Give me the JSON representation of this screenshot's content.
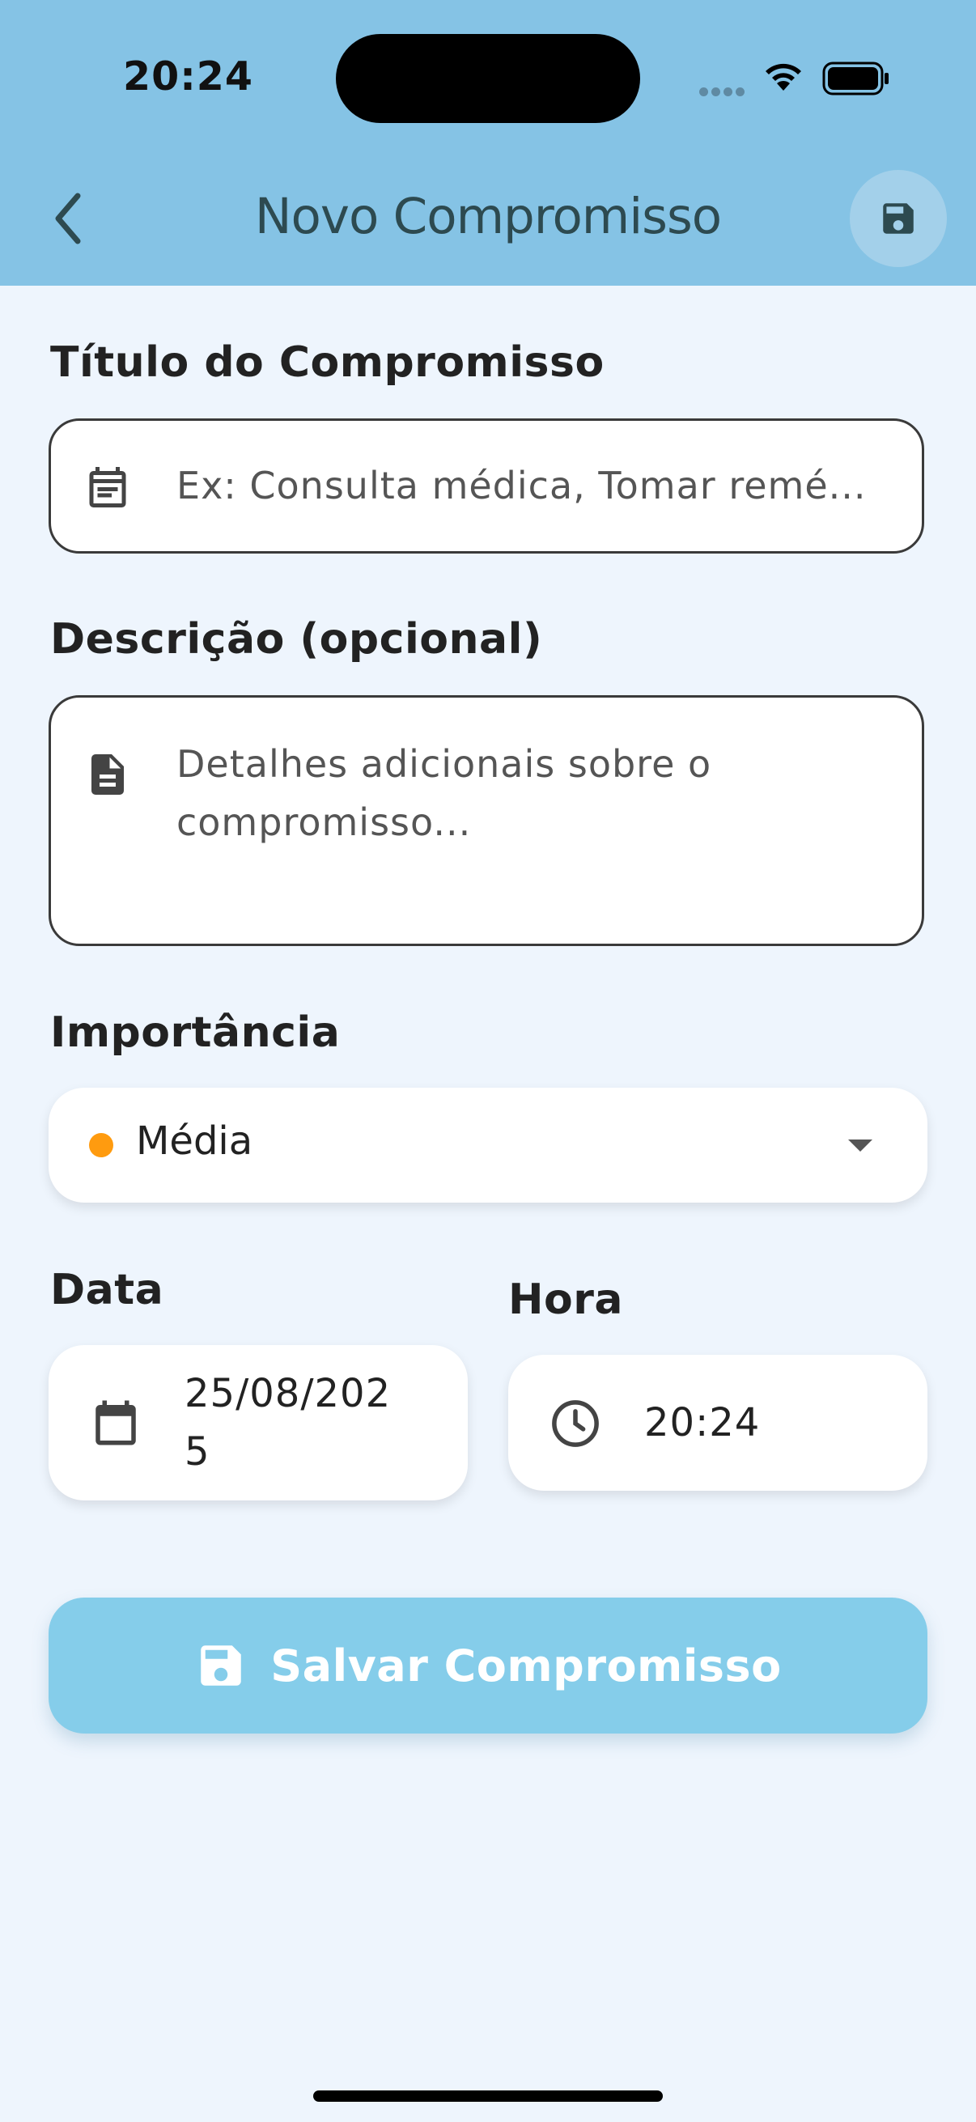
{
  "status_bar": {
    "time": "20:24"
  },
  "header": {
    "title": "Novo Compromisso"
  },
  "form": {
    "title_label": "Título do Compromisso",
    "title_placeholder": "Ex: Consulta médica, Tomar remé...",
    "description_label": "Descrição (opcional)",
    "description_placeholder": "Detalhes adicionais sobre o compromisso...",
    "importance_label": "Importância",
    "importance_value": "Média",
    "date_label": "Data",
    "date_value": "25/08/2025",
    "time_label": "Hora",
    "time_value": "20:24",
    "save_button": "Salvar Compromisso"
  },
  "colors": {
    "header_bg": "#85C3E5",
    "page_bg": "#EEF5FD",
    "importance_medium": "#FF9B0F",
    "primary_button": "#85CDEA"
  },
  "icons": [
    "back-chevron-icon",
    "save-icon",
    "calendar-icon",
    "document-icon",
    "dropdown-arrow-icon",
    "clock-icon",
    "wifi-icon",
    "battery-icon"
  ]
}
